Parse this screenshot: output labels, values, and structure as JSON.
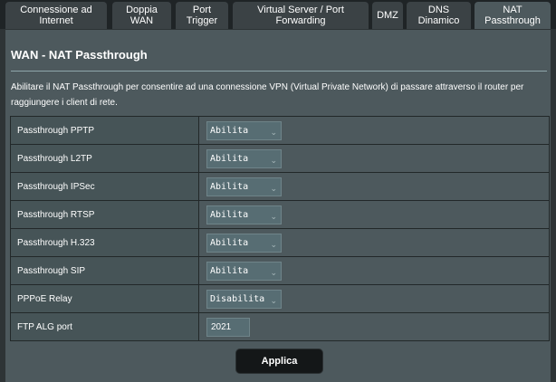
{
  "tabs": [
    {
      "label_line1": "Connessione ad",
      "label_line2": "Internet"
    },
    {
      "label_line1": "Doppia",
      "label_line2": "WAN"
    },
    {
      "label_line1": "Port",
      "label_line2": "Trigger"
    },
    {
      "label_line1": "Virtual Server / Port",
      "label_line2": "Forwarding"
    },
    {
      "label_line1": "DMZ",
      "label_line2": ""
    },
    {
      "label_line1": "DNS",
      "label_line2": "Dinamico"
    },
    {
      "label_line1": "NAT",
      "label_line2": "Passthrough",
      "active": true
    }
  ],
  "page": {
    "title": "WAN - NAT Passthrough",
    "description": "Abilitare il NAT Passthrough per consentire ad una connessione VPN (Virtual Private Network) di passare attraverso il router per raggiungere i client di rete."
  },
  "settings": [
    {
      "label": "Passthrough PPTP",
      "value": "Abilita"
    },
    {
      "label": "Passthrough L2TP",
      "value": "Abilita"
    },
    {
      "label": "Passthrough IPSec",
      "value": "Abilita"
    },
    {
      "label": "Passthrough RTSP",
      "value": "Abilita"
    },
    {
      "label": "Passthrough H.323",
      "value": "Abilita"
    },
    {
      "label": "Passthrough SIP",
      "value": "Abilita"
    },
    {
      "label": "PPPoE Relay",
      "value": "Disabilita"
    },
    {
      "label": "FTP ALG port",
      "value": "2021"
    }
  ],
  "apply_label": "Applica",
  "icons": {
    "dropdown": "chevron-down-icon"
  },
  "colors": {
    "background": "#2e3436",
    "panel": "#4d595d",
    "tab": "#3b4245",
    "button": "#141718"
  }
}
